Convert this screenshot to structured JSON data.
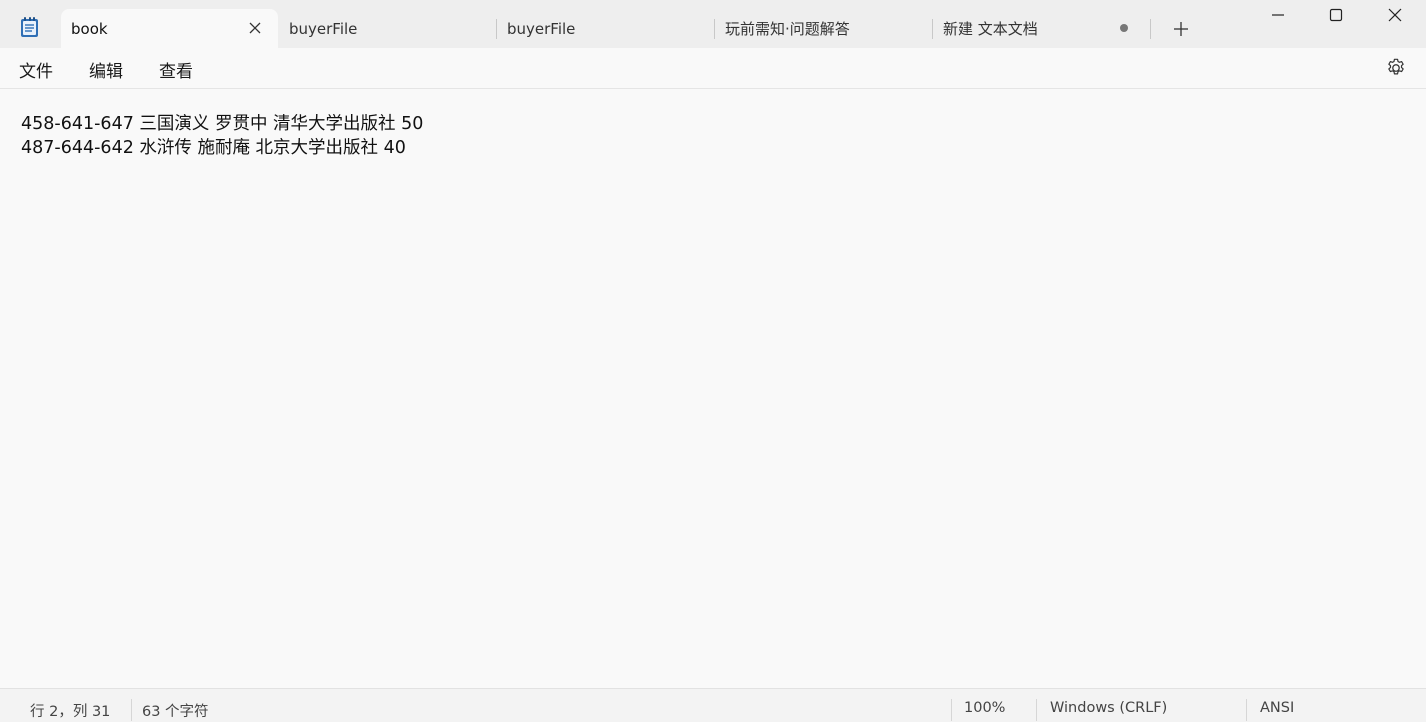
{
  "tabs": [
    {
      "label": "book",
      "active": true
    },
    {
      "label": "buyerFile",
      "active": false
    },
    {
      "label": "buyerFile",
      "active": false
    },
    {
      "label": "玩前需知·问题解答",
      "active": false
    },
    {
      "label": "新建 文本文档",
      "active": false,
      "unsaved": true
    }
  ],
  "menu": {
    "file": "文件",
    "edit": "编辑",
    "view": "查看"
  },
  "editor": {
    "lines": [
      "458-641-647 三国演义 罗贯中 清华大学出版社 50",
      "487-644-642 水浒传 施耐庵 北京大学出版社 40"
    ]
  },
  "status": {
    "position": "行 2，列 31",
    "char_count": "63 个字符",
    "zoom": "100%",
    "line_ending": "Windows (CRLF)",
    "encoding": "ANSI"
  },
  "colors": {
    "titlebar": "#eeeeee",
    "background": "#f9f9f9",
    "icon_accent": "#2b6cb0"
  }
}
